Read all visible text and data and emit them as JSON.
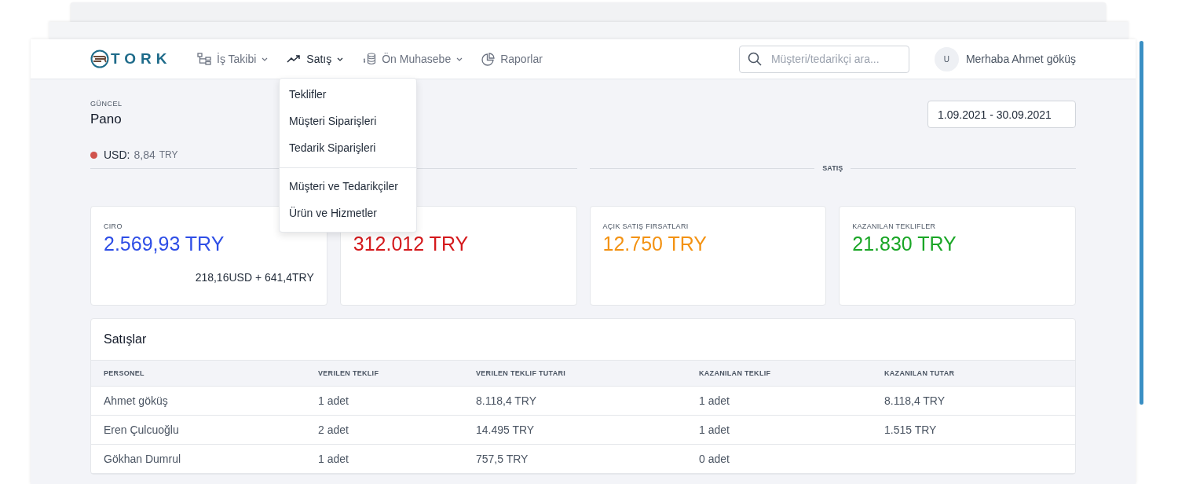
{
  "brand": {
    "name": "TORK"
  },
  "nav": [
    {
      "label": "İş Takibi",
      "kind": "tree",
      "has_menu": true,
      "selected": false
    },
    {
      "label": "Satış",
      "kind": "trend",
      "has_menu": true,
      "selected": true
    },
    {
      "label": "Ön Muhasebe",
      "kind": "coins",
      "has_menu": true,
      "selected": false
    },
    {
      "label": "Raporlar",
      "kind": "pie",
      "has_menu": false,
      "selected": false
    }
  ],
  "search": {
    "placeholder": "Müşteri/tedarikçi ara..."
  },
  "user": {
    "initial": "U",
    "greeting": "Merhaba Ahmet göküş"
  },
  "dropdown": {
    "groups": [
      [
        "Teklifler",
        "Müşteri Siparişleri",
        "Tedarik Siparişleri"
      ],
      [
        "Müşteri ve Tedarikçiler",
        "Ürün ve Hizmetler"
      ]
    ]
  },
  "header": {
    "overline": "GÜNCEL",
    "title": "Pano",
    "date_range": "1.09.2021 - 30.09.2021"
  },
  "rate": {
    "label": "USD:",
    "value": "8,84",
    "unit": "TRY",
    "color": "#d0524c"
  },
  "sales_section": {
    "label": "SATIŞ"
  },
  "cards": [
    {
      "label": "CIRO",
      "value": "2.569,93 TRY",
      "color": "#2e4ee6",
      "note": "218,16USD + 641,4TRY"
    },
    {
      "value": "312.012 TRY",
      "color": "#d4191c"
    },
    {
      "label": "AÇIK SATIŞ FIRSATLARI",
      "value": "12.750 TRY",
      "color": "#f39212"
    },
    {
      "label": "KAZANILAN TEKLIFLER",
      "value": "21.830 TRY",
      "color": "#1aa626"
    }
  ],
  "table": {
    "title": "Satışlar",
    "columns": [
      "PERSONEL",
      "VERILEN TEKLIF",
      "VERILEN TEKLIF TUTARI",
      "KAZANILAN TEKLIF",
      "KAZANILAN TUTAR"
    ],
    "rows": [
      [
        "Ahmet göküş",
        "1 adet",
        "8.118,4 TRY",
        "1 adet",
        "8.118,4 TRY"
      ],
      [
        "Eren Çulcuoğlu",
        "2 adet",
        "14.495 TRY",
        "1 adet",
        "1.515 TRY"
      ],
      [
        "Gökhan Dumrul",
        "1 adet",
        "757,5 TRY",
        "0 adet",
        ""
      ]
    ]
  }
}
